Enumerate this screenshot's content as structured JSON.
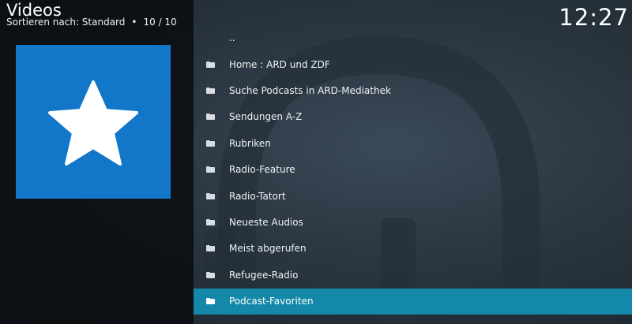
{
  "header": {
    "title": "Videos",
    "sort_label": "Sortieren nach: Standard",
    "separator": "•",
    "count": "10 / 10"
  },
  "clock": "12:27",
  "thumbnail": {
    "icon": "star-icon",
    "background": "#1276c9"
  },
  "list": {
    "parent_label": "..",
    "items": [
      {
        "label": "Home : ARD und ZDF",
        "icon": "folder-icon"
      },
      {
        "label": "Suche Podcasts in ARD-Mediathek",
        "icon": "folder-icon"
      },
      {
        "label": "Sendungen A-Z",
        "icon": "folder-icon"
      },
      {
        "label": "Rubriken",
        "icon": "folder-icon"
      },
      {
        "label": "Radio-Feature",
        "icon": "folder-icon"
      },
      {
        "label": "Radio-Tatort",
        "icon": "folder-icon"
      },
      {
        "label": "Neueste Audios",
        "icon": "folder-icon"
      },
      {
        "label": "Meist abgerufen",
        "icon": "folder-icon"
      },
      {
        "label": "Refugee-Radio",
        "icon": "folder-icon"
      },
      {
        "label": "Podcast-Favoriten",
        "icon": "folder-icon",
        "selected": true
      }
    ]
  },
  "colors": {
    "accent": "#1388a8",
    "thumbnail": "#1276c9",
    "background": "#1f2a33"
  }
}
